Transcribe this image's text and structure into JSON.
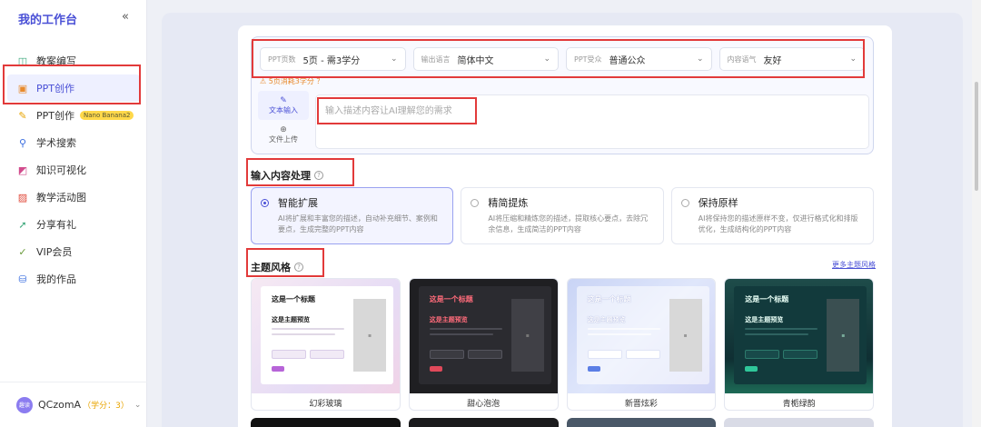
{
  "sidebar": {
    "brand": "我的工作台",
    "collapse_icon": "«",
    "items": [
      {
        "label": "教案编写",
        "icon": "◫",
        "color": "#3aa77a"
      },
      {
        "label": "PPT创作",
        "icon": "▣",
        "color": "#e88a2c"
      },
      {
        "label": "PPT创作",
        "icon": "✎",
        "color": "#e8a400",
        "badge": "Nano Banana2"
      },
      {
        "label": "学术搜索",
        "icon": "⚲",
        "color": "#3a6ee0"
      },
      {
        "label": "知识可视化",
        "icon": "◩",
        "color": "#d24c8d"
      },
      {
        "label": "教学活动图",
        "icon": "▨",
        "color": "#e0493a"
      },
      {
        "label": "分享有礼",
        "icon": "➚",
        "color": "#3aa77a"
      },
      {
        "label": "VIP会员",
        "icon": "✓",
        "color": "#6a9a3a"
      },
      {
        "label": "我的作品",
        "icon": "⛁",
        "color": "#3a6ee0"
      }
    ],
    "active_index": 1,
    "user": {
      "avatar": "趣读",
      "name": "QCzomA",
      "credit": "（学分：3）",
      "caret": "⌄"
    }
  },
  "form": {
    "selects": [
      {
        "label": "PPT页数",
        "value": "5页 - 需3学分"
      },
      {
        "label": "输出语言",
        "value": "简体中文"
      },
      {
        "label": "PPT受众",
        "value": "普通公众"
      },
      {
        "label": "内容语气",
        "value": "友好"
      }
    ],
    "warning": "⚠ 5页消耗3学分 ？",
    "modes": [
      {
        "icon": "✎",
        "label": "文本输入"
      },
      {
        "icon": "⊕",
        "label": "文件上传"
      }
    ],
    "placeholder": "输入描述内容让AI理解您的需求"
  },
  "processing": {
    "title": "输入内容处理",
    "help_icon": "?",
    "options": [
      {
        "title": "智能扩展",
        "desc": "AI将扩展和丰富您的描述，自动补充细节、案例和要点，生成完整的PPT内容"
      },
      {
        "title": "精简提炼",
        "desc": "AI将压缩和精炼您的描述，提取核心要点，去除冗余信息，生成简洁的PPT内容"
      },
      {
        "title": "保持原样",
        "desc": "AI将保持您的描述原样不变，仅进行格式化和排版优化，生成结构化的PPT内容"
      }
    ],
    "selected_index": 0
  },
  "themes": {
    "title": "主题风格",
    "help_icon": "?",
    "more": "更多主题风格",
    "items": [
      {
        "name": "幻彩玻璃",
        "slide_title": "这是一个标题",
        "slide_sub": "这是主题预览"
      },
      {
        "name": "甜心泡泡",
        "slide_title": "这是一个标题",
        "slide_sub": "这是主题预览"
      },
      {
        "name": "新晋炫彩",
        "slide_title": "这是一个标题",
        "slide_sub": "这是主题预览"
      },
      {
        "name": "青栀绿韵",
        "slide_title": "这是一个标题",
        "slide_sub": "这是主题预览"
      }
    ],
    "image_placeholder": "▪"
  },
  "accent_color": "#4a50d6",
  "highlight_color": "#e23a3a"
}
